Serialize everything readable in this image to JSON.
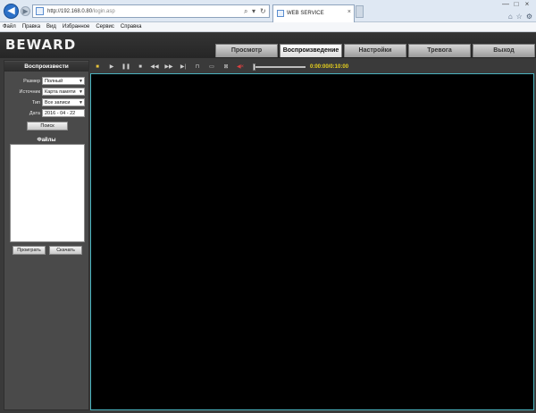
{
  "browser": {
    "url_host": "http://192.168.0.80",
    "url_path": "/login.asp",
    "tab_title": "WEB SERVICE",
    "tab_close": "×",
    "search_glyph": "⌕",
    "dropdown_glyph": "▾",
    "refresh_glyph": "↻",
    "window_min": "—",
    "window_max": "□",
    "window_close": "×",
    "home_glyph": "⌂",
    "fav_glyph": "☆",
    "tools_glyph": "⚙"
  },
  "menu": [
    "Файл",
    "Правка",
    "Вид",
    "Избранное",
    "Сервис",
    "Справка"
  ],
  "app": {
    "logo": "BEWARD",
    "nav": [
      {
        "label": "Просмотр",
        "active": false
      },
      {
        "label": "Воспроизведение",
        "active": true
      },
      {
        "label": "Настройки",
        "active": false
      },
      {
        "label": "Тревога",
        "active": false
      },
      {
        "label": "Выход",
        "active": false
      }
    ]
  },
  "playback": {
    "title": "Воспроизвести",
    "fields": {
      "size_label": "Размер",
      "size_value": "Полный",
      "source_label": "Источник",
      "source_value": "Карта памяти",
      "type_label": "Тип",
      "type_value": "Все записи",
      "date_label": "Дата",
      "date_value": "2016 - 04 - 22"
    },
    "search_button": "Поиск",
    "files_label": "Файлы",
    "play_button": "Проиграть",
    "download_button": "Скачать"
  },
  "player": {
    "time": "0:00:00/0:10:00",
    "seek_fraction": 0.0,
    "snapshot_color": "#e6c23a",
    "mute_color": "#d94040"
  },
  "colors": {
    "video_border": "#4bb3bf",
    "time_text": "#e8d21d"
  }
}
